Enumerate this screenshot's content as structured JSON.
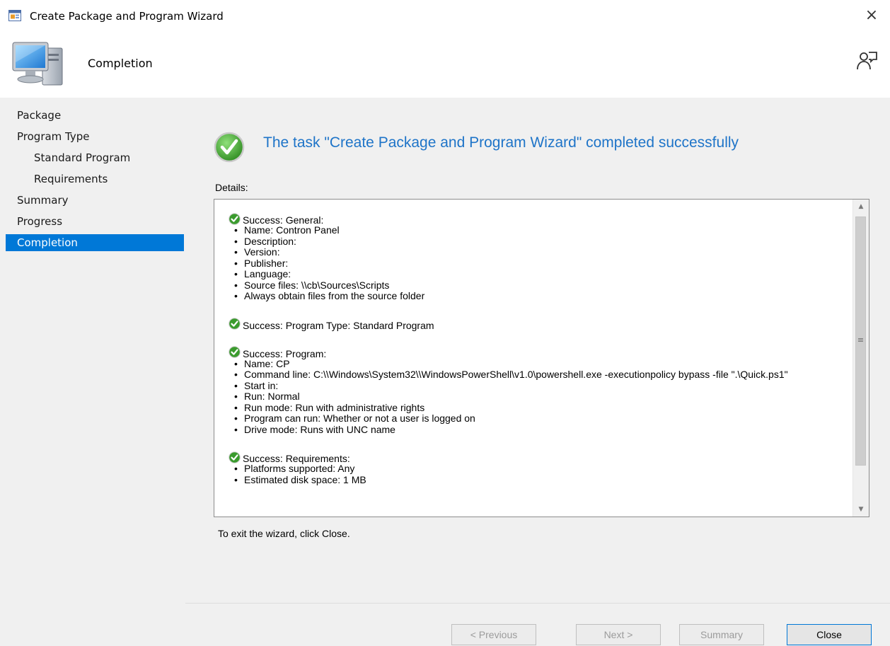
{
  "window": {
    "title": "Create Package and Program Wizard",
    "close_label": "×"
  },
  "header": {
    "page_title": "Completion"
  },
  "sidebar": {
    "items": [
      {
        "label": "Package",
        "level": 0
      },
      {
        "label": "Program Type",
        "level": 0
      },
      {
        "label": "Standard Program",
        "level": 1
      },
      {
        "label": "Requirements",
        "level": 1
      },
      {
        "label": "Summary",
        "level": 0
      },
      {
        "label": "Progress",
        "level": 0
      },
      {
        "label": "Completion",
        "level": 0,
        "active": true
      }
    ]
  },
  "main": {
    "success_message": "The task \"Create Package and Program Wizard\" completed successfully",
    "details_label": "Details:",
    "sections": [
      {
        "heading": "Success: General:",
        "items": [
          "Name: Contron Panel",
          "Description:",
          "Version:",
          "Publisher:",
          "Language:",
          "Source files: \\\\cb\\Sources\\Scripts",
          "Always obtain files from the source folder"
        ]
      },
      {
        "heading": "Success: Program Type: Standard Program",
        "items": []
      },
      {
        "heading": "Success: Program:",
        "items": [
          "Name: CP",
          "Command line: C:\\\\Windows\\System32\\\\WindowsPowerShell\\v1.0\\powershell.exe -executionpolicy bypass -file \".\\Quick.ps1\"",
          "Start in:",
          "Run: Normal",
          "Run mode: Run with administrative rights",
          "Program can run: Whether or not a user is logged on",
          "Drive mode: Runs with UNC name"
        ]
      },
      {
        "heading": "Success: Requirements:",
        "items": [
          "Platforms supported: Any",
          "Estimated disk space: 1 MB"
        ]
      }
    ],
    "exit_text": "To exit the wizard, click Close."
  },
  "buttons": {
    "previous": "< Previous",
    "next": "Next >",
    "summary": "Summary",
    "close": "Close"
  },
  "colors": {
    "accent": "#0078d7",
    "success_text": "#1e74c8",
    "success_green": "#3a9b2d"
  },
  "icons": {
    "app": "wizard-app-icon",
    "header": "computer-icon",
    "help": "help-person-icon",
    "success": "success-check-icon"
  }
}
